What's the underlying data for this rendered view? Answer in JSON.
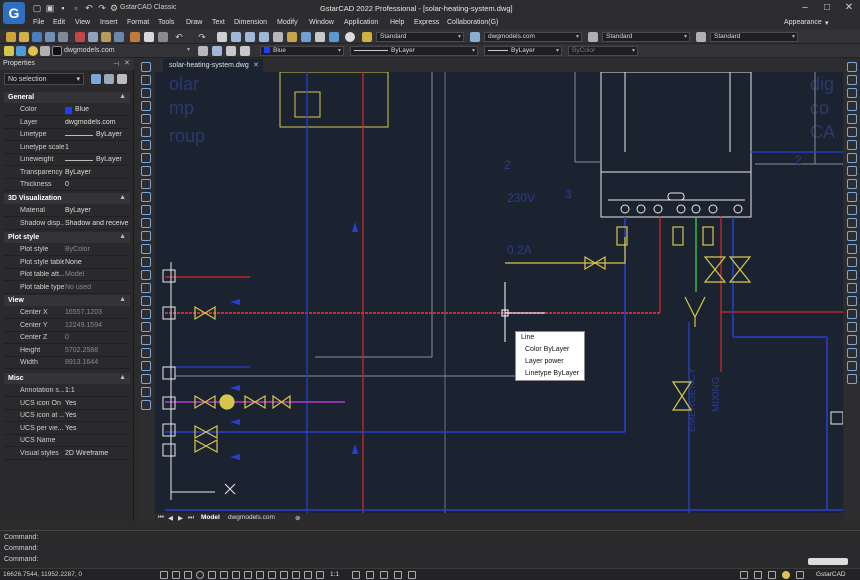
{
  "window": {
    "workspace": "GstarCAD Classic",
    "title": "GstarCAD 2022 Professional - [solar-heating-system.dwg]",
    "appearance": "Appearance"
  },
  "menu": [
    "File",
    "Edit",
    "View",
    "Insert",
    "Format",
    "Tools",
    "Draw",
    "Text",
    "Dimension",
    "Modify",
    "Window",
    "Application",
    "Help",
    "Express",
    "Collaboration(G)"
  ],
  "toolbar": {
    "text_style": "Standard",
    "dim_style": "dwgmodels.com",
    "table_style": "Standard",
    "multileader_style": "Standard",
    "layer": "dwgmodels.com",
    "color": "Blue",
    "linetype": "ByLayer",
    "lineweight": "ByLayer",
    "plotstyle": "ByColor"
  },
  "properties": {
    "title": "Properties",
    "selection": "No selection",
    "sections": {
      "general": "General",
      "visualization": "3D Visualization",
      "plot_style": "Plot style",
      "view": "View",
      "misc": "Misc"
    },
    "general": [
      {
        "k": "Color",
        "v": "Blue"
      },
      {
        "k": "Layer",
        "v": "dwgmodels.com"
      },
      {
        "k": "Linetype",
        "v": "ByLayer"
      },
      {
        "k": "Linetype scale",
        "v": "1"
      },
      {
        "k": "Lineweight",
        "v": "ByLayer"
      },
      {
        "k": "Transparency",
        "v": "ByLayer"
      },
      {
        "k": "Thickness",
        "v": "0"
      }
    ],
    "visualization": [
      {
        "k": "Material",
        "v": "ByLayer"
      },
      {
        "k": "Shadow disp...",
        "v": "Shadow and receive ..."
      }
    ],
    "plot_style": [
      {
        "k": "Plot style",
        "v": "ByColor"
      },
      {
        "k": "Plot style table",
        "v": "None"
      },
      {
        "k": "Plot table att...",
        "v": "Model"
      },
      {
        "k": "Plot table type",
        "v": "No used"
      }
    ],
    "view": [
      {
        "k": "Center X",
        "v": "16557.1203"
      },
      {
        "k": "Center Y",
        "v": "12249.1594"
      },
      {
        "k": "Center Z",
        "v": "0"
      },
      {
        "k": "Height",
        "v": "5702.2588"
      },
      {
        "k": "Width",
        "v": "8913.1644"
      }
    ],
    "misc": [
      {
        "k": "Annotation s...",
        "v": "1:1"
      },
      {
        "k": "UCS icon On",
        "v": "Yes"
      },
      {
        "k": "UCS icon at ...",
        "v": "Yes"
      },
      {
        "k": "UCS per vie...",
        "v": "Yes"
      },
      {
        "k": "UCS Name",
        "v": ""
      },
      {
        "k": "Visual styles",
        "v": "2D Wireframe"
      }
    ]
  },
  "document_tab": "solar-heating-system.dwg",
  "layout_tabs": [
    "Model",
    "dwgmodels.com"
  ],
  "drawing_text": {
    "t1": "olar",
    "t2": "mp",
    "t3": "roup",
    "t4": "dig",
    "t5": "co",
    "t6": "CA",
    "num2a": "2",
    "num2b": "2",
    "num3": "3",
    "v230": "230V",
    "v2": "0.2A",
    "vertical1": "EMERGENCY",
    "vertical2": "MIXING"
  },
  "tooltip": {
    "type": "Line",
    "color": "Color  ByLayer",
    "layer": "Layer  power",
    "linetype": "Linetype  ByLayer"
  },
  "command": [
    "Command:",
    "Command:",
    "Command:"
  ],
  "status": {
    "coords": "16626.7544, 11952.2287, 0",
    "scale": "1:1",
    "app": "GstarCAD"
  },
  "colors": {
    "canvas": "#1c2330",
    "red_pipe": "#d42a2a",
    "blue_pipe": "#2a3fd0",
    "yellow_valve": "#d8c64a",
    "magenta": "#b03ac8",
    "green": "#2fbf3a",
    "white_line": "#e8e8e8",
    "grey_line": "#8a8f99"
  }
}
